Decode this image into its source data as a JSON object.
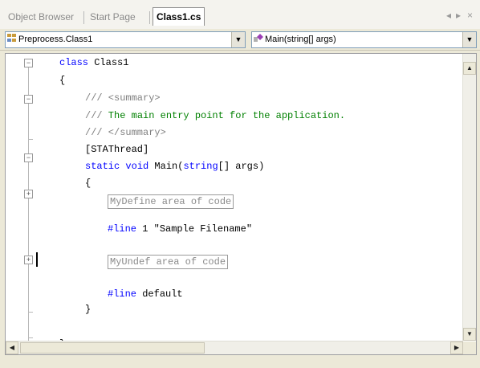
{
  "tabs": {
    "items": [
      {
        "label": "Object Browser",
        "active": false
      },
      {
        "label": "Start Page",
        "active": false
      },
      {
        "label": "Class1.cs",
        "active": true
      }
    ],
    "nav_prev": "◂",
    "nav_next": "▸",
    "close": "×"
  },
  "dropdowns": {
    "type_value": "Preprocess.Class1",
    "member_value": "Main(string[] args)",
    "type_icon": "class-icon",
    "member_icon": "method-icon"
  },
  "code": {
    "class_kw": "class",
    "class_name": " Class1",
    "open_brace_1": "{",
    "summary_open": "/// <summary>",
    "summary_slashes": "///",
    "summary_text": " The main entry point for the application.",
    "summary_close": "/// </summary>",
    "attribute": "[STAThread]",
    "static_kw": "static",
    "void_kw": " void",
    "main_sig": " Main(",
    "string_kw": "string",
    "main_args": "[] args)",
    "open_brace_2": "{",
    "region_define": "MyDefine area of code",
    "line_kw_1": "#line",
    "line_args_1": " 1 \"Sample Filename\"",
    "region_undef": "MyUndef area of code",
    "line_kw_2": "#line",
    "line_args_2": " default",
    "close_brace_2": "}",
    "close_brace_1": "}"
  }
}
